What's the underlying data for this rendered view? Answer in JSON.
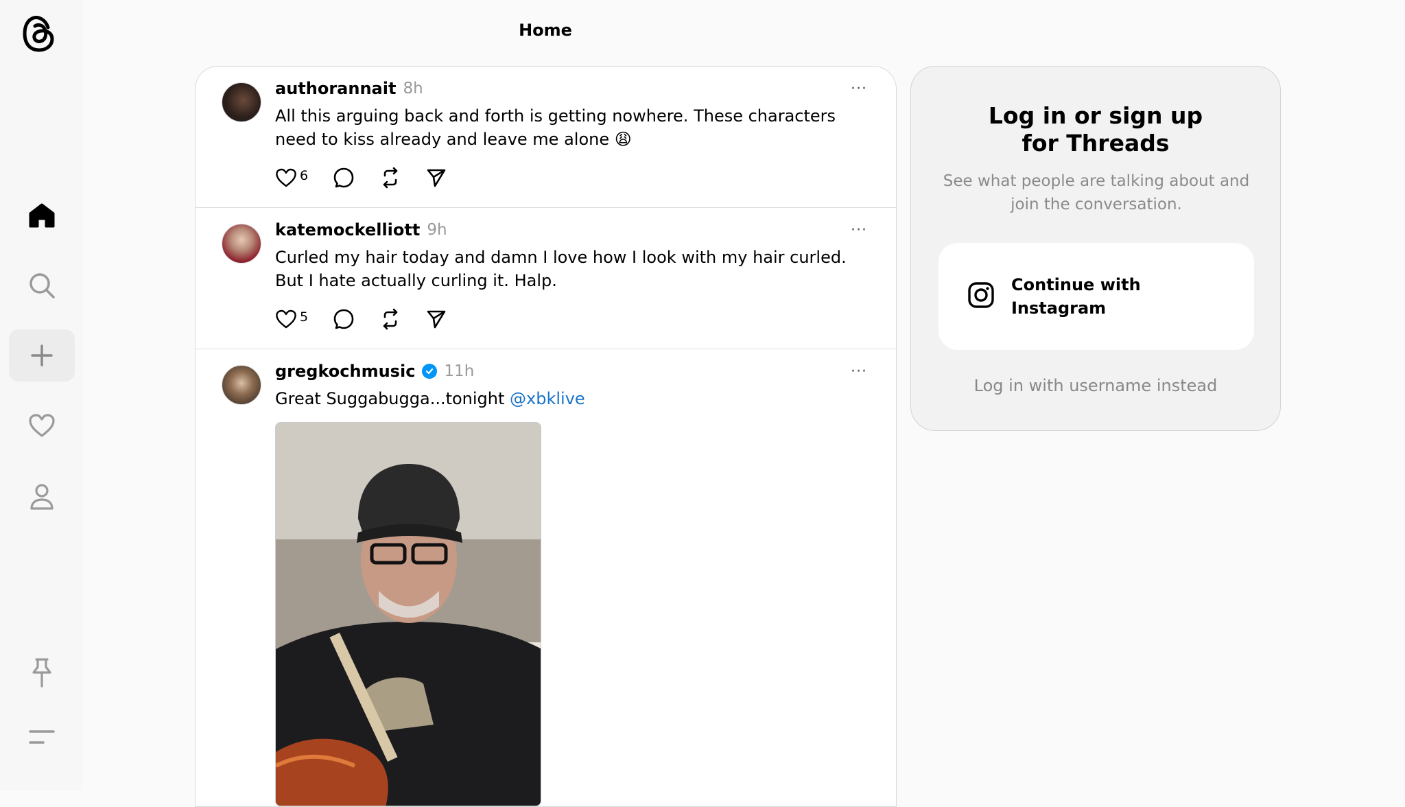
{
  "header": {
    "title": "Home"
  },
  "sidebar": {
    "items": [
      {
        "name": "home",
        "icon": "home-icon"
      },
      {
        "name": "search",
        "icon": "search-icon"
      },
      {
        "name": "create",
        "icon": "plus-icon"
      },
      {
        "name": "activity",
        "icon": "heart-icon"
      },
      {
        "name": "profile",
        "icon": "person-icon"
      },
      {
        "name": "pinned",
        "icon": "pin-icon"
      },
      {
        "name": "menu",
        "icon": "menu-icon"
      }
    ]
  },
  "posts": [
    {
      "username": "authorannait",
      "time": "8h",
      "text": "All this arguing back and forth is getting nowhere. These characters need to kiss already and leave me alone 😩",
      "likes": "6",
      "more": "···"
    },
    {
      "username": "katemockelliott",
      "time": "9h",
      "text": "Curled my hair today and damn I love how I look with my hair curled. But I hate actually curling it. Halp.",
      "likes": "5",
      "more": "···"
    },
    {
      "username": "gregkochmusic",
      "time": "11h",
      "verified": true,
      "text": "Great Suggabugga...tonight ",
      "mention": "@xbklive",
      "more": "···"
    }
  ],
  "login_panel": {
    "title_line1": "Log in or sign up",
    "title_line2": "for Threads",
    "subtitle": "See what people are talking about and join the conversation.",
    "instagram_button": "Continue with Instagram",
    "username_link": "Log in with username instead"
  },
  "colors": {
    "background": "#fafafa",
    "mention": "#1a74c8",
    "verified": "#0095f6",
    "muted_text": "#8a8a8a"
  }
}
